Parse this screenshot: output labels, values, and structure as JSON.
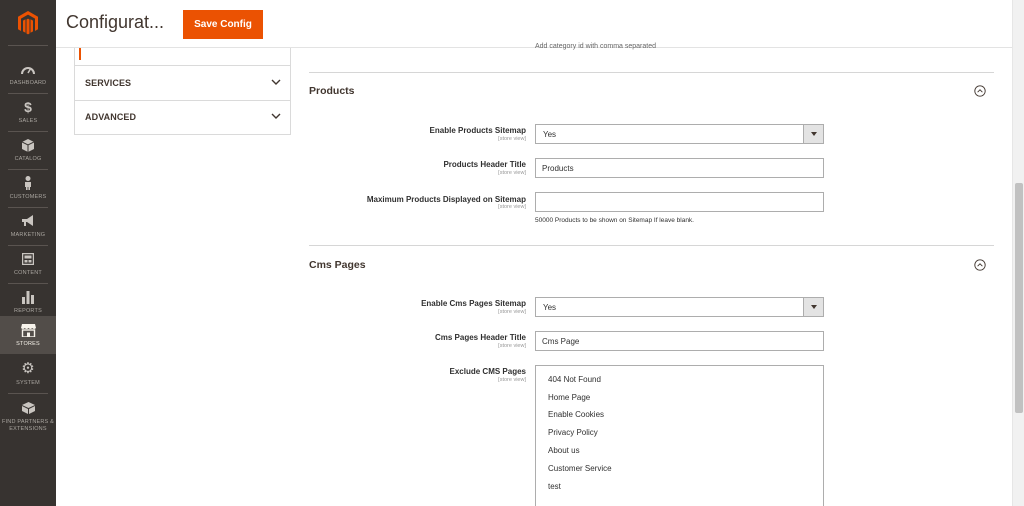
{
  "colors": {
    "accent": "#eb5202",
    "nav_bg": "#373330",
    "nav_active": "#524d49"
  },
  "header": {
    "title": "Configurat...",
    "save_label": "Save Config"
  },
  "nav": {
    "items": [
      {
        "label": "DASHBOARD",
        "icon": "dashboard-icon"
      },
      {
        "label": "SALES",
        "icon": "dollar-icon"
      },
      {
        "label": "CATALOG",
        "icon": "cube-icon"
      },
      {
        "label": "CUSTOMERS",
        "icon": "person-icon"
      },
      {
        "label": "MARKETING",
        "icon": "megaphone-icon"
      },
      {
        "label": "CONTENT",
        "icon": "layout-icon"
      },
      {
        "label": "REPORTS",
        "icon": "bar-chart-icon"
      },
      {
        "label": "STORES",
        "icon": "storefront-icon",
        "active": true
      },
      {
        "label": "SYSTEM",
        "icon": "gear-icon"
      },
      {
        "label": "FIND PARTNERS & EXTENSIONS",
        "icon": "box-icon"
      }
    ]
  },
  "config_tabs": {
    "groups": [
      {
        "label": "SERVICES",
        "icon": "chevron-down-icon"
      },
      {
        "label": "ADVANCED",
        "icon": "chevron-down-icon"
      }
    ]
  },
  "top_note": "Add category id with comma separated",
  "products": {
    "title": "Products",
    "enable": {
      "label": "Enable Products Sitemap",
      "scope": "[store view]",
      "value": "Yes"
    },
    "header_title": {
      "label": "Products Header Title",
      "scope": "[store view]",
      "value": "Products"
    },
    "max": {
      "label": "Maximum Products Displayed on Sitemap",
      "scope": "[store view]",
      "value": "",
      "note": "50000 Products to be shown on Sitemap If leave blank."
    }
  },
  "cms": {
    "title": "Cms Pages",
    "enable": {
      "label": "Enable Cms Pages Sitemap",
      "scope": "[store view]",
      "value": "Yes"
    },
    "header_title": {
      "label": "Cms Pages Header Title",
      "scope": "[store view]",
      "value": "Cms Page"
    },
    "exclude": {
      "label": "Exclude CMS Pages",
      "scope": "[store view]",
      "options": [
        "404 Not Found",
        "Home Page",
        "Enable Cookies",
        "Privacy Policy",
        "About us",
        "Customer Service",
        "test"
      ]
    }
  }
}
